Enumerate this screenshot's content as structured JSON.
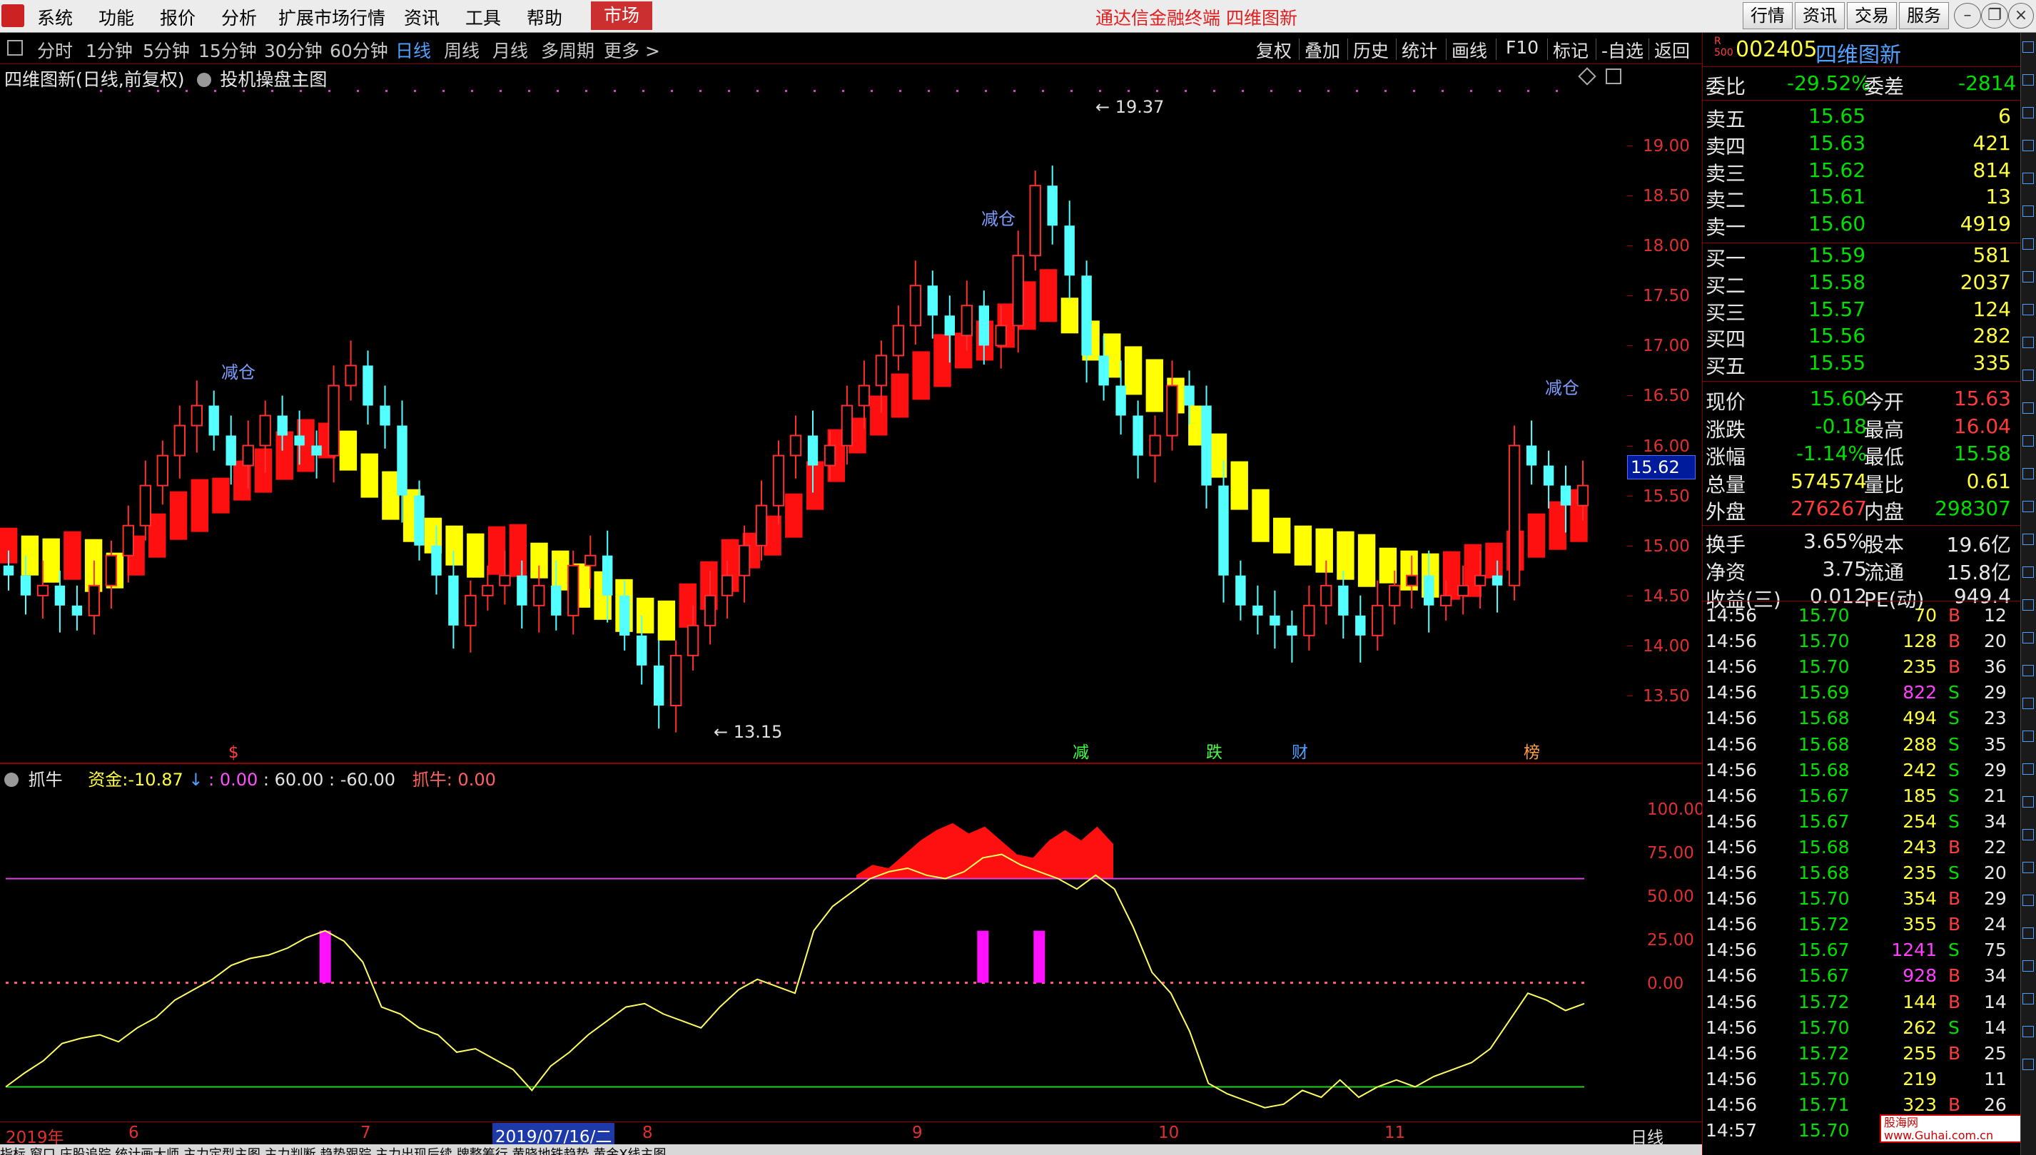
{
  "menu": {
    "items": [
      "系统",
      "功能",
      "报价",
      "分析",
      "扩展市场行情",
      "资讯",
      "工具",
      "帮助"
    ],
    "market": "市场",
    "banner": "通达信金融终端  四维图新",
    "right_buttons": [
      "行情",
      "资讯",
      "交易",
      "服务"
    ]
  },
  "periods": {
    "items": [
      "分时",
      "1分钟",
      "5分钟",
      "15分钟",
      "30分钟",
      "60分钟",
      "日线",
      "周线",
      "月线",
      "多周期",
      "更多 >"
    ],
    "active": "日线"
  },
  "tools": [
    "复权",
    "叠加",
    "历史",
    "统计",
    "画线",
    "F10",
    "标记",
    "-自选",
    "返回"
  ],
  "chart_header": {
    "title": "四维图新(日线,前复权)",
    "indicator": "投机操盘主图"
  },
  "sub_header": {
    "name": "抓牛",
    "fund_label": "资金:",
    "fund_value": "-10.87",
    "v1": ": 0.00",
    "v2": ": 60.00",
    "v3": ": -60.00",
    "bull": "抓牛: 0.00"
  },
  "price_labels": {
    "high": "19.37",
    "low": "13.15",
    "current": "15.62"
  },
  "annotations": {
    "reduce": "减仓"
  },
  "signals": [
    "$",
    "减",
    "跌",
    "财",
    "榜"
  ],
  "date_axis": {
    "labels": [
      "2019年",
      "6",
      "7",
      "2019/07/16/二",
      "8",
      "9",
      "10",
      "11"
    ],
    "period": "日线"
  },
  "chart_data": [
    {
      "type": "candlestick",
      "title": "四维图新(日线,前复权)",
      "ylim": [
        13.0,
        19.6
      ],
      "yticks": [
        13.5,
        14.0,
        14.5,
        15.0,
        15.5,
        16.0,
        16.5,
        17.0,
        17.5,
        18.0,
        18.5,
        19.0
      ],
      "high": 19.37,
      "low": 13.15,
      "last": 15.62,
      "closes": [
        14.7,
        14.5,
        14.6,
        14.4,
        14.3,
        14.6,
        14.9,
        15.2,
        15.6,
        15.9,
        16.2,
        16.4,
        16.1,
        15.8,
        16.0,
        16.3,
        16.1,
        16.0,
        15.9,
        16.6,
        16.8,
        16.4,
        16.2,
        15.5,
        15.0,
        14.7,
        14.2,
        14.5,
        14.6,
        14.7,
        14.4,
        14.6,
        14.3,
        14.8,
        14.9,
        14.5,
        14.1,
        13.8,
        13.4,
        13.9,
        14.2,
        14.5,
        14.7,
        15.0,
        15.4,
        15.9,
        16.1,
        15.8,
        16.0,
        16.4,
        16.6,
        16.9,
        17.2,
        17.6,
        17.3,
        17.1,
        17.4,
        17.0,
        17.2,
        17.9,
        18.6,
        18.2,
        17.7,
        16.9,
        16.6,
        16.3,
        15.9,
        16.1,
        16.6,
        16.4,
        15.6,
        14.7,
        14.4,
        14.3,
        14.2,
        14.1,
        14.4,
        14.6,
        14.3,
        14.1,
        14.4,
        14.6,
        14.7,
        14.4,
        14.5,
        14.6,
        14.7,
        14.6,
        16.0,
        15.8,
        15.6,
        15.4,
        15.6
      ],
      "band_values": [
        15.0,
        14.9,
        14.85,
        14.9,
        14.8,
        14.75,
        14.9,
        15.1,
        15.3,
        15.4,
        15.5,
        15.65,
        15.75,
        15.9,
        16.0,
        16.05,
        15.95,
        15.7,
        15.5,
        15.3,
        15.1,
        15.0,
        14.9,
        14.95,
        14.95,
        14.85,
        14.75,
        14.6,
        14.5,
        14.4,
        14.3,
        14.25,
        14.4,
        14.6,
        14.8,
        14.95,
        15.1,
        15.3,
        15.6,
        15.9,
        16.1,
        16.3,
        16.5,
        16.7,
        16.85,
        16.95,
        17.05,
        17.2,
        17.4,
        17.5,
        17.3,
        17.05,
        16.9,
        16.75,
        16.6,
        16.5,
        16.2,
        15.9,
        15.6,
        15.3,
        15.1,
        15.0,
        14.95,
        14.9,
        14.85,
        14.8,
        14.75,
        14.7,
        14.7,
        14.75,
        14.85,
        14.95,
        15.1,
        15.2,
        15.3
      ],
      "series": [
        {
          "name": "band-up",
          "color": "#ff1010"
        },
        {
          "name": "band-down",
          "color": "#ffff00"
        }
      ]
    },
    {
      "type": "line",
      "title": "抓牛",
      "ylim": [
        -75,
        110
      ],
      "yticks": [
        100.0,
        75.0,
        50.0,
        25.0,
        0.0
      ],
      "levels": [
        60,
        0,
        -60
      ],
      "values": [
        -60,
        -52,
        -45,
        -35,
        -32,
        -30,
        -34,
        -26,
        -20,
        -10,
        -4,
        2,
        10,
        14,
        16,
        20,
        26,
        30,
        24,
        12,
        -14,
        -18,
        -26,
        -30,
        -40,
        -38,
        -44,
        -50,
        -62,
        -48,
        -40,
        -30,
        -22,
        -14,
        -12,
        -18,
        -22,
        -26,
        -14,
        -4,
        2,
        -2,
        -6,
        30,
        44,
        52,
        60,
        64,
        66,
        62,
        60,
        64,
        72,
        74,
        68,
        64,
        60,
        54,
        62,
        54,
        32,
        6,
        -6,
        -28,
        -58,
        -64,
        -68,
        -72,
        -70,
        -62,
        -66,
        -56,
        -66,
        -60,
        -56,
        -60,
        -54,
        -50,
        -46,
        -38,
        -22,
        -6,
        -10,
        -16,
        -12
      ],
      "area_values": [
        62,
        68,
        66,
        74,
        82,
        88,
        92,
        86,
        90,
        82,
        74,
        72,
        82,
        88,
        82,
        90,
        80
      ],
      "pulses": [
        {
          "x": 17,
          "value": 30
        },
        {
          "x": 52,
          "value": 30
        },
        {
          "x": 55,
          "value": 30
        }
      ]
    }
  ],
  "quote": {
    "code": "002405",
    "name": "四维图新",
    "weibi_label": "委比",
    "weibi": "-29.52%",
    "weicha_label": "委差",
    "weicha": "-2814",
    "asks": [
      {
        "label": "卖五",
        "price": "15.65",
        "vol": "6"
      },
      {
        "label": "卖四",
        "price": "15.63",
        "vol": "421"
      },
      {
        "label": "卖三",
        "price": "15.62",
        "vol": "814"
      },
      {
        "label": "卖二",
        "price": "15.61",
        "vol": "13"
      },
      {
        "label": "卖一",
        "price": "15.60",
        "vol": "4919"
      }
    ],
    "bids": [
      {
        "label": "买一",
        "price": "15.59",
        "vol": "581"
      },
      {
        "label": "买二",
        "price": "15.58",
        "vol": "2037"
      },
      {
        "label": "买三",
        "price": "15.57",
        "vol": "124"
      },
      {
        "label": "买四",
        "price": "15.56",
        "vol": "282"
      },
      {
        "label": "买五",
        "price": "15.55",
        "vol": "335"
      }
    ],
    "stats": [
      {
        "l1": "现价",
        "v1": "15.60",
        "c1": "down",
        "l2": "今开",
        "v2": "15.63",
        "c2": "up"
      },
      {
        "l1": "涨跌",
        "v1": "-0.18",
        "c1": "down",
        "l2": "最高",
        "v2": "16.04",
        "c2": "up"
      },
      {
        "l1": "涨幅",
        "v1": "-1.14%",
        "c1": "down",
        "l2": "最低",
        "v2": "15.58",
        "c2": "down"
      },
      {
        "l1": "总量",
        "v1": "574574",
        "c1": "yel",
        "l2": "量比",
        "v2": "0.61",
        "c2": "yel"
      },
      {
        "l1": "外盘",
        "v1": "276267",
        "c1": "up",
        "l2": "内盘",
        "v2": "298307",
        "c2": "down"
      }
    ],
    "stats2": [
      {
        "l1": "换手",
        "v1": "3.65%",
        "l2": "股本",
        "v2": "19.6亿"
      },
      {
        "l1": "净资",
        "v1": "3.75",
        "l2": "流通",
        "v2": "15.8亿"
      },
      {
        "l1": "收益(三)",
        "v1": "0.012",
        "l2": "PE(动)",
        "v2": "949.4"
      }
    ]
  },
  "ticks": [
    {
      "t": "14:56",
      "p": "15.70",
      "v": "70",
      "s": "B",
      "n": "12"
    },
    {
      "t": "14:56",
      "p": "15.70",
      "v": "128",
      "s": "B",
      "n": "20"
    },
    {
      "t": "14:56",
      "p": "15.70",
      "v": "235",
      "s": "B",
      "n": "36"
    },
    {
      "t": "14:56",
      "p": "15.69",
      "v": "822",
      "s": "S",
      "n": "29"
    },
    {
      "t": "14:56",
      "p": "15.68",
      "v": "494",
      "s": "S",
      "n": "23"
    },
    {
      "t": "14:56",
      "p": "15.68",
      "v": "288",
      "s": "S",
      "n": "35"
    },
    {
      "t": "14:56",
      "p": "15.68",
      "v": "242",
      "s": "S",
      "n": "29"
    },
    {
      "t": "14:56",
      "p": "15.67",
      "v": "185",
      "s": "S",
      "n": "21"
    },
    {
      "t": "14:56",
      "p": "15.67",
      "v": "254",
      "s": "S",
      "n": "34"
    },
    {
      "t": "14:56",
      "p": "15.68",
      "v": "243",
      "s": "B",
      "n": "22"
    },
    {
      "t": "14:56",
      "p": "15.68",
      "v": "235",
      "s": "S",
      "n": "20"
    },
    {
      "t": "14:56",
      "p": "15.70",
      "v": "354",
      "s": "B",
      "n": "29"
    },
    {
      "t": "14:56",
      "p": "15.72",
      "v": "355",
      "s": "B",
      "n": "24"
    },
    {
      "t": "14:56",
      "p": "15.67",
      "v": "1241",
      "s": "S",
      "n": "75"
    },
    {
      "t": "14:56",
      "p": "15.67",
      "v": "928",
      "s": "B",
      "n": "34"
    },
    {
      "t": "14:56",
      "p": "15.72",
      "v": "144",
      "s": "B",
      "n": "14"
    },
    {
      "t": "14:56",
      "p": "15.70",
      "v": "262",
      "s": "S",
      "n": "14"
    },
    {
      "t": "14:56",
      "p": "15.72",
      "v": "255",
      "s": "B",
      "n": "25"
    },
    {
      "t": "14:56",
      "p": "15.70",
      "v": "219",
      "s": "",
      "n": "11"
    },
    {
      "t": "14:56",
      "p": "15.71",
      "v": "323",
      "s": "B",
      "n": "26"
    },
    {
      "t": "14:57",
      "p": "15.70",
      "v": "",
      "s": "",
      "n": ""
    }
  ],
  "watermark": "股海网 www.Guhai.com.cn",
  "bottom_tabs": "指标  窗口  庄股追踪  统计画大师  主力定型主图  主力判断  趋势跟踪  主力出现后续  牌整筹行  黄晓地铁趋势  黄金X线主图"
}
